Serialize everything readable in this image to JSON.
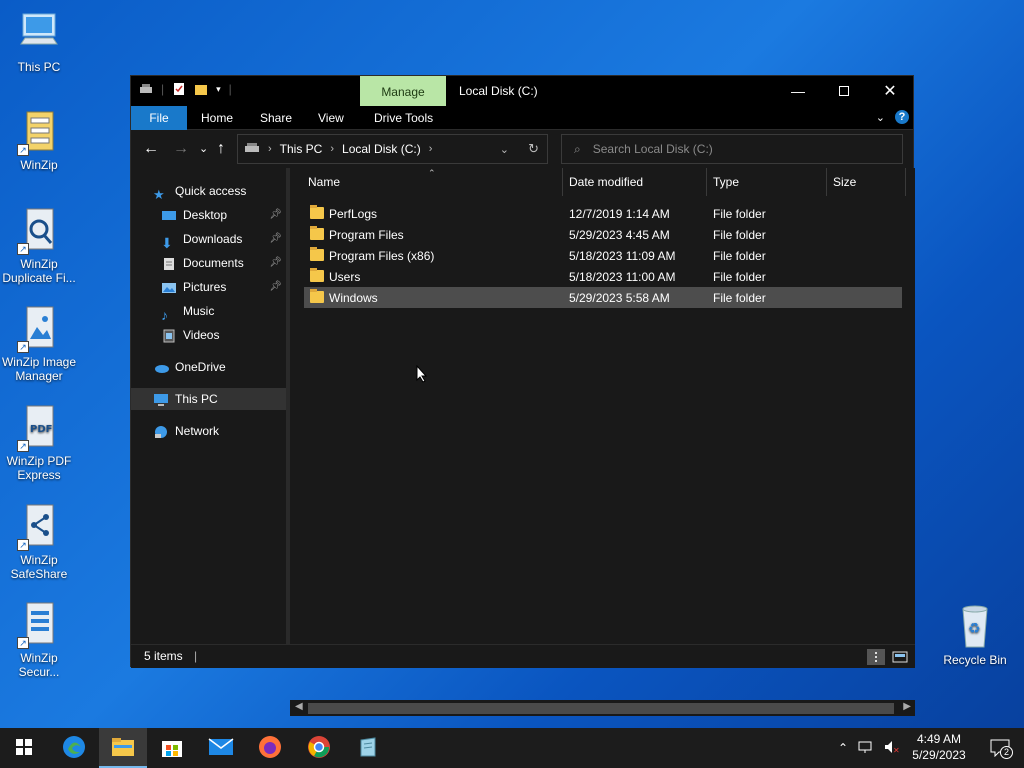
{
  "desktop": {
    "icons": [
      {
        "label": "This PC"
      },
      {
        "label": "WinZip"
      },
      {
        "label": "WinZip Duplicate Fi..."
      },
      {
        "label": "WinZip Image Manager"
      },
      {
        "label": "WinZip PDF Express"
      },
      {
        "label": "WinZip SafeShare"
      },
      {
        "label": "WinZip Secur..."
      },
      {
        "label": "Recycle Bin"
      }
    ]
  },
  "window": {
    "title": "Local Disk (C:)",
    "context_tab": "Manage",
    "ribbon": {
      "file": "File",
      "home": "Home",
      "share": "Share",
      "view": "View",
      "drive_tools": "Drive Tools"
    },
    "address": {
      "segments": [
        "This PC",
        "Local Disk (C:)"
      ]
    },
    "search": {
      "placeholder": "Search Local Disk (C:)"
    },
    "nav": {
      "quick_access": "Quick access",
      "items": [
        "Desktop",
        "Downloads",
        "Documents",
        "Pictures",
        "Music",
        "Videos"
      ],
      "onedrive": "OneDrive",
      "this_pc": "This PC",
      "network": "Network"
    },
    "columns": {
      "name": "Name",
      "date": "Date modified",
      "type": "Type",
      "size": "Size"
    },
    "files": [
      {
        "name": "PerfLogs",
        "date": "12/7/2019 1:14 AM",
        "type": "File folder"
      },
      {
        "name": "Program Files",
        "date": "5/29/2023 4:45 AM",
        "type": "File folder"
      },
      {
        "name": "Program Files (x86)",
        "date": "5/18/2023 11:09 AM",
        "type": "File folder"
      },
      {
        "name": "Users",
        "date": "5/18/2023 11:00 AM",
        "type": "File folder"
      },
      {
        "name": "Windows",
        "date": "5/29/2023 5:58 AM",
        "type": "File folder"
      }
    ],
    "status": "5 items"
  },
  "taskbar": {
    "time": "4:49 AM",
    "date": "5/29/2023",
    "notifications": "2"
  },
  "colors": {
    "accent": "#1979ca",
    "manage_tab": "#b9e6a6",
    "desktop": "#1b7ae0"
  }
}
